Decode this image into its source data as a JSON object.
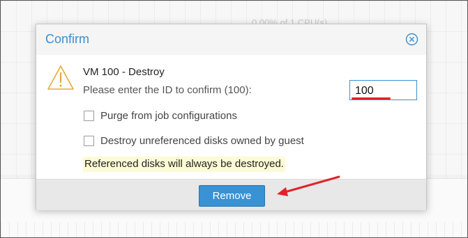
{
  "background": {
    "cpu_text": "0.00% of 1 CPU(s)"
  },
  "dialog": {
    "title": "Confirm",
    "close_icon": "close-circle-icon",
    "warning_icon": "warning-triangle-icon",
    "heading": "VM 100 - Destroy",
    "prompt": "Please enter the ID to confirm (100):",
    "id_value": "100",
    "options": [
      {
        "label": "Purge from job configurations",
        "checked": false
      },
      {
        "label": "Destroy unreferenced disks owned by guest",
        "checked": false
      }
    ],
    "note": "Referenced disks will always be destroyed.",
    "remove_label": "Remove"
  },
  "colors": {
    "accent": "#3892d3",
    "title": "#3b8fd1",
    "warning": "#e5a93b",
    "annotation": "#e0232b",
    "note_bg": "#fdfbd5"
  }
}
